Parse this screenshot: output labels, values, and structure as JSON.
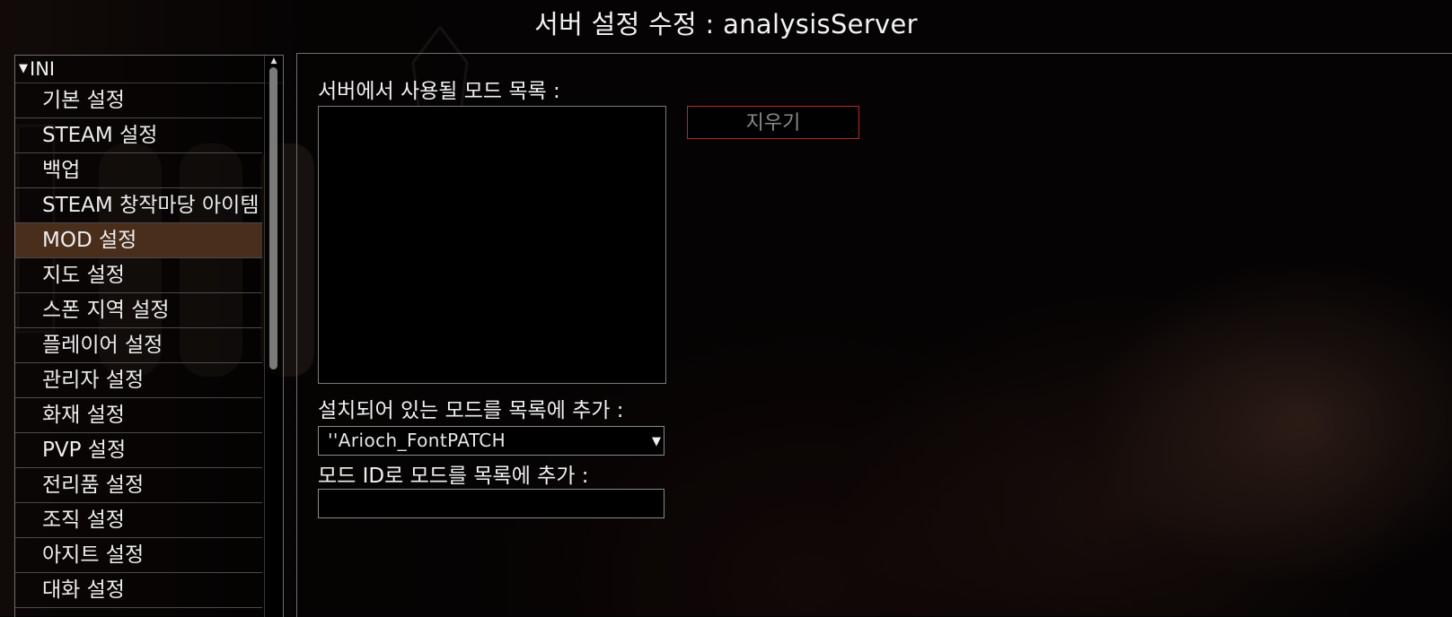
{
  "window": {
    "title": "서버 설정 수정 : analysisServer"
  },
  "sidebar": {
    "root_label": "INI",
    "items": [
      {
        "label": "기본 설정"
      },
      {
        "label": "STEAM 설정"
      },
      {
        "label": "백업"
      },
      {
        "label": "STEAM 창작마당 아이템 설정"
      },
      {
        "label": "MOD 설정",
        "selected": true
      },
      {
        "label": "지도 설정"
      },
      {
        "label": "스폰 지역 설정"
      },
      {
        "label": "플레이어 설정"
      },
      {
        "label": "관리자 설정"
      },
      {
        "label": "화재 설정"
      },
      {
        "label": "PVP 설정"
      },
      {
        "label": "전리품 설정"
      },
      {
        "label": "조직 설정"
      },
      {
        "label": "아지트 설정"
      },
      {
        "label": "대화 설정"
      }
    ]
  },
  "main": {
    "mod_list_label": "서버에서 사용될 모드 목록 :",
    "clear_button": "지우기",
    "add_installed_label": "설치되어 있는 모드를 목록에 추가 :",
    "installed_select_value": "''Arioch_FontPATCH",
    "add_by_id_label": "모드 ID로 모드를 목록에 추가 :",
    "mod_id_value": ""
  },
  "colors": {
    "selected_item_bg": "#4a2e1c",
    "clear_button_border": "#b02a24",
    "border": "#6e6e6e"
  },
  "icons": {
    "tree_expand": "triangle-down",
    "scroll_up": "triangle-up",
    "dropdown": "triangle-down"
  }
}
